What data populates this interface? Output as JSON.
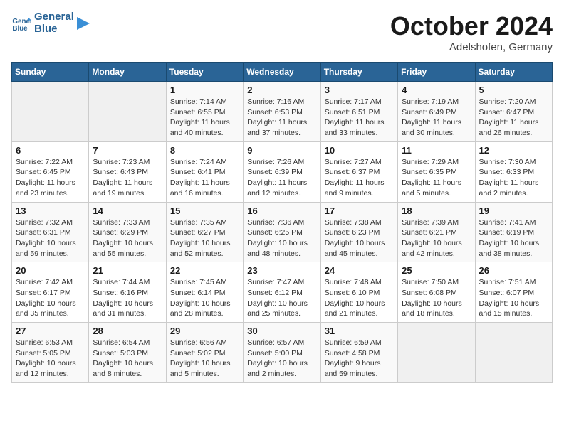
{
  "header": {
    "logo_line1": "General",
    "logo_line2": "Blue",
    "month": "October 2024",
    "location": "Adelshofen, Germany"
  },
  "days_of_week": [
    "Sunday",
    "Monday",
    "Tuesday",
    "Wednesday",
    "Thursday",
    "Friday",
    "Saturday"
  ],
  "weeks": [
    [
      {
        "day": "",
        "empty": true
      },
      {
        "day": "",
        "empty": true
      },
      {
        "day": "1",
        "sunrise": "7:14 AM",
        "sunset": "6:55 PM",
        "daylight": "11 hours and 40 minutes."
      },
      {
        "day": "2",
        "sunrise": "7:16 AM",
        "sunset": "6:53 PM",
        "daylight": "11 hours and 37 minutes."
      },
      {
        "day": "3",
        "sunrise": "7:17 AM",
        "sunset": "6:51 PM",
        "daylight": "11 hours and 33 minutes."
      },
      {
        "day": "4",
        "sunrise": "7:19 AM",
        "sunset": "6:49 PM",
        "daylight": "11 hours and 30 minutes."
      },
      {
        "day": "5",
        "sunrise": "7:20 AM",
        "sunset": "6:47 PM",
        "daylight": "11 hours and 26 minutes."
      }
    ],
    [
      {
        "day": "6",
        "sunrise": "7:22 AM",
        "sunset": "6:45 PM",
        "daylight": "11 hours and 23 minutes."
      },
      {
        "day": "7",
        "sunrise": "7:23 AM",
        "sunset": "6:43 PM",
        "daylight": "11 hours and 19 minutes."
      },
      {
        "day": "8",
        "sunrise": "7:24 AM",
        "sunset": "6:41 PM",
        "daylight": "11 hours and 16 minutes."
      },
      {
        "day": "9",
        "sunrise": "7:26 AM",
        "sunset": "6:39 PM",
        "daylight": "11 hours and 12 minutes."
      },
      {
        "day": "10",
        "sunrise": "7:27 AM",
        "sunset": "6:37 PM",
        "daylight": "11 hours and 9 minutes."
      },
      {
        "day": "11",
        "sunrise": "7:29 AM",
        "sunset": "6:35 PM",
        "daylight": "11 hours and 5 minutes."
      },
      {
        "day": "12",
        "sunrise": "7:30 AM",
        "sunset": "6:33 PM",
        "daylight": "11 hours and 2 minutes."
      }
    ],
    [
      {
        "day": "13",
        "sunrise": "7:32 AM",
        "sunset": "6:31 PM",
        "daylight": "10 hours and 59 minutes."
      },
      {
        "day": "14",
        "sunrise": "7:33 AM",
        "sunset": "6:29 PM",
        "daylight": "10 hours and 55 minutes."
      },
      {
        "day": "15",
        "sunrise": "7:35 AM",
        "sunset": "6:27 PM",
        "daylight": "10 hours and 52 minutes."
      },
      {
        "day": "16",
        "sunrise": "7:36 AM",
        "sunset": "6:25 PM",
        "daylight": "10 hours and 48 minutes."
      },
      {
        "day": "17",
        "sunrise": "7:38 AM",
        "sunset": "6:23 PM",
        "daylight": "10 hours and 45 minutes."
      },
      {
        "day": "18",
        "sunrise": "7:39 AM",
        "sunset": "6:21 PM",
        "daylight": "10 hours and 42 minutes."
      },
      {
        "day": "19",
        "sunrise": "7:41 AM",
        "sunset": "6:19 PM",
        "daylight": "10 hours and 38 minutes."
      }
    ],
    [
      {
        "day": "20",
        "sunrise": "7:42 AM",
        "sunset": "6:17 PM",
        "daylight": "10 hours and 35 minutes."
      },
      {
        "day": "21",
        "sunrise": "7:44 AM",
        "sunset": "6:16 PM",
        "daylight": "10 hours and 31 minutes."
      },
      {
        "day": "22",
        "sunrise": "7:45 AM",
        "sunset": "6:14 PM",
        "daylight": "10 hours and 28 minutes."
      },
      {
        "day": "23",
        "sunrise": "7:47 AM",
        "sunset": "6:12 PM",
        "daylight": "10 hours and 25 minutes."
      },
      {
        "day": "24",
        "sunrise": "7:48 AM",
        "sunset": "6:10 PM",
        "daylight": "10 hours and 21 minutes."
      },
      {
        "day": "25",
        "sunrise": "7:50 AM",
        "sunset": "6:08 PM",
        "daylight": "10 hours and 18 minutes."
      },
      {
        "day": "26",
        "sunrise": "7:51 AM",
        "sunset": "6:07 PM",
        "daylight": "10 hours and 15 minutes."
      }
    ],
    [
      {
        "day": "27",
        "sunrise": "6:53 AM",
        "sunset": "5:05 PM",
        "daylight": "10 hours and 12 minutes."
      },
      {
        "day": "28",
        "sunrise": "6:54 AM",
        "sunset": "5:03 PM",
        "daylight": "10 hours and 8 minutes."
      },
      {
        "day": "29",
        "sunrise": "6:56 AM",
        "sunset": "5:02 PM",
        "daylight": "10 hours and 5 minutes."
      },
      {
        "day": "30",
        "sunrise": "6:57 AM",
        "sunset": "5:00 PM",
        "daylight": "10 hours and 2 minutes."
      },
      {
        "day": "31",
        "sunrise": "6:59 AM",
        "sunset": "4:58 PM",
        "daylight": "9 hours and 59 minutes."
      },
      {
        "day": "",
        "empty": true
      },
      {
        "day": "",
        "empty": true
      }
    ]
  ]
}
